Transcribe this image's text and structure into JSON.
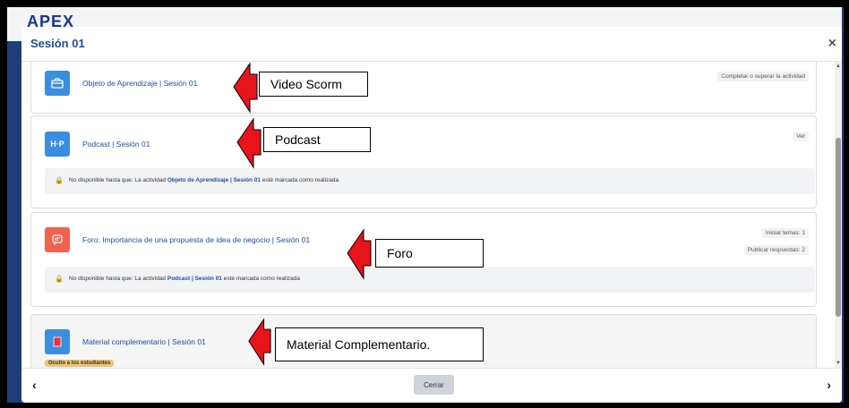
{
  "background": {
    "logo": "APEX"
  },
  "modal": {
    "title": "Sesión 01",
    "close": "×"
  },
  "activities": [
    {
      "name": "Objeto de Aprendizaje | Sesión 01",
      "icon": "package-icon",
      "icon_color": "#3b8de0",
      "status": "Completar o superar la actividad"
    },
    {
      "name": "Podcast | Sesión 01",
      "icon": "h5p-icon",
      "icon_glyph": "H·P",
      "icon_color": "#3b8de0",
      "status": "Ver",
      "restriction": {
        "prefix": "No disponible hasta que: La actividad ",
        "link": "Objeto de Aprendizaje | Sesión 01",
        "suffix": " esté marcada como realizada"
      }
    },
    {
      "name": "Foro: Importancia de una propuesta de idea de negocio | Sesión 01",
      "icon": "forum-icon",
      "icon_color": "#f0624d",
      "status1": "Iniciar temas: 1",
      "status2": "Publicar respuestas: 2",
      "restriction": {
        "prefix": "No disponible hasta que: La actividad ",
        "link": "Podcast | Sesión 01",
        "suffix": " esté marcada como realizada"
      }
    },
    {
      "name": "Material complementario | Sesión 01",
      "icon": "file-icon",
      "icon_color": "#3b8de0",
      "badge": "Oculto a los estudiantes"
    }
  ],
  "annotations": [
    "Video Scorm",
    "Podcast",
    "Foro",
    "Material Complementario."
  ],
  "footer": {
    "prev": "‹",
    "next": "›",
    "close_button": "Cerrar"
  },
  "colors": {
    "accent": "#1a4f9c",
    "arrow": "#e8141b"
  }
}
